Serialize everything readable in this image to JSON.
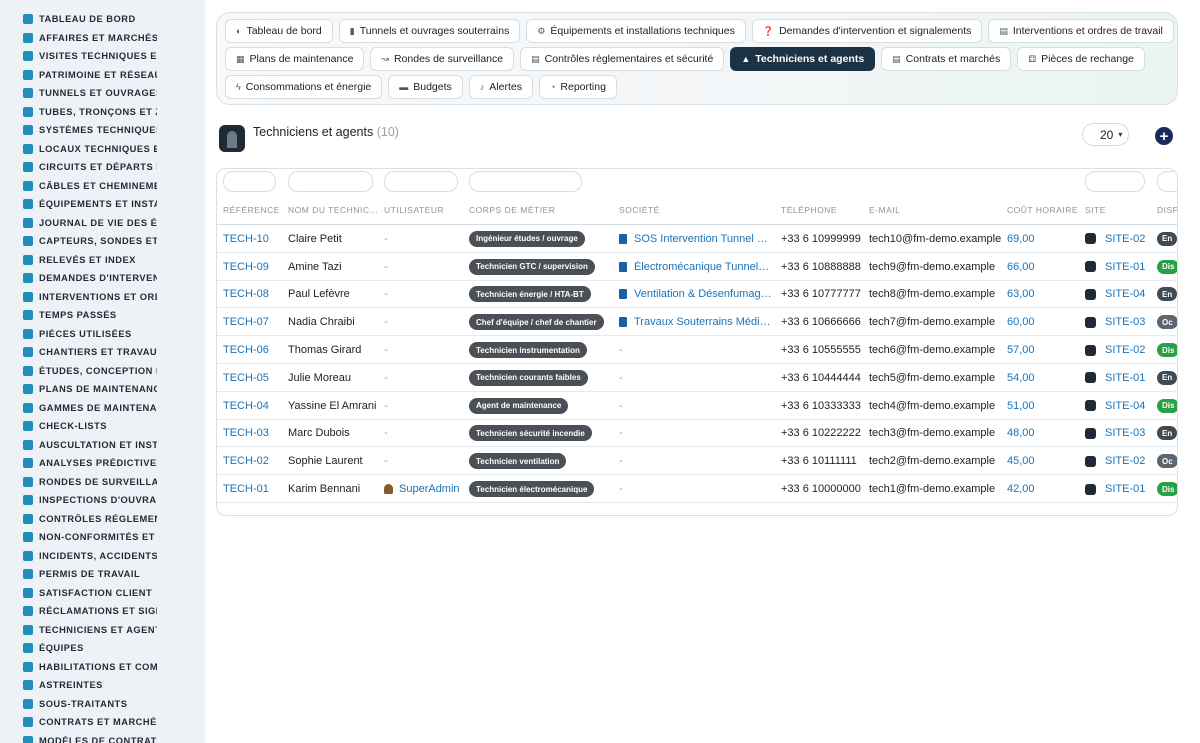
{
  "sidebar": {
    "items": [
      {
        "label": "TABLEAU DE BORD",
        "icon": "dashboard-icon"
      },
      {
        "label": "AFFAIRES ET MARCHÉS",
        "icon": "target-icon"
      },
      {
        "label": "VISITES TECHNIQUES ET",
        "icon": "ruler-icon"
      },
      {
        "label": "PATRIMOINE ET RÉSEAUX",
        "icon": "flag-icon"
      },
      {
        "label": "TUNNELS ET OUVRAGES",
        "icon": "building-icon"
      },
      {
        "label": "TUBES, TRONÇONS ET ZO",
        "icon": "dots-icon"
      },
      {
        "label": "SYSTÈMES TECHNIQUES",
        "icon": "sitemap-icon"
      },
      {
        "label": "LOCAUX TECHNIQUES ET",
        "icon": "grid-icon"
      },
      {
        "label": "CIRCUITS ET DÉPARTS É",
        "icon": "bolt-icon"
      },
      {
        "label": "CÂBLES ET CHEMINEMEN",
        "icon": "cable-icon"
      },
      {
        "label": "ÉQUIPEMENTS ET INSTAL",
        "icon": "gears-icon"
      },
      {
        "label": "JOURNAL DE VIE DES ÉQ",
        "icon": "history-icon"
      },
      {
        "label": "CAPTEURS, SONDES ET C",
        "icon": "sensor-icon"
      },
      {
        "label": "RELEVÉS ET INDEX",
        "icon": "list-icon"
      },
      {
        "label": "DEMANDES D'INTERVENT",
        "icon": "question-icon"
      },
      {
        "label": "INTERVENTIONS ET ORDI",
        "icon": "clipboard-icon"
      },
      {
        "label": "TEMPS PASSÉS",
        "icon": "clock-icon"
      },
      {
        "label": "PIÈCES UTILISÉES",
        "icon": "puzzle-icon"
      },
      {
        "label": "CHANTIERS ET TRAVAUX",
        "icon": "hammer-icon"
      },
      {
        "label": "ÉTUDES, CONCEPTION ET",
        "icon": "pencil-icon"
      },
      {
        "label": "PLANS DE MAINTENANCE",
        "icon": "calendar-icon"
      },
      {
        "label": "GAMMES DE MAINTENAN",
        "icon": "layers-icon"
      },
      {
        "label": "CHECK-LISTS",
        "icon": "checklist-icon"
      },
      {
        "label": "AUSCULTATION ET INSTR",
        "icon": "stethoscope-icon"
      },
      {
        "label": "ANALYSES PRÉDICTIVES",
        "icon": "chart-line-icon"
      },
      {
        "label": "RONDES DE SURVEILLAN",
        "icon": "route-icon"
      },
      {
        "label": "INSPECTIONS D'OUVRAG",
        "icon": "magnifier-icon"
      },
      {
        "label": "CONTRÔLES RÉGLEMENT",
        "icon": "clipboard-check-icon"
      },
      {
        "label": "NON-CONFORMITÉS ET A",
        "icon": "exclamation-icon"
      },
      {
        "label": "INCIDENTS, ACCIDENTS E",
        "icon": "warning-icon"
      },
      {
        "label": "PERMIS DE TRAVAIL",
        "icon": "document-icon"
      },
      {
        "label": "SATISFACTION CLIENT",
        "icon": "smile-icon"
      },
      {
        "label": "RÉCLAMATIONS ET SIGN",
        "icon": "comment-icon"
      },
      {
        "label": "TECHNICIENS ET AGENTS",
        "icon": "hardhat-icon"
      },
      {
        "label": "ÉQUIPES",
        "icon": "users-icon"
      },
      {
        "label": "HABILITATIONS ET COMP",
        "icon": "certificate-icon"
      },
      {
        "label": "ASTREINTES",
        "icon": "phone-icon"
      },
      {
        "label": "SOUS-TRAITANTS",
        "icon": "handshake-icon"
      },
      {
        "label": "CONTRATS ET MARCHÉS",
        "icon": "contract-icon"
      },
      {
        "label": "MODÈLES DE CONTRATS",
        "icon": "file-icon"
      }
    ]
  },
  "tabs": {
    "rows": [
      [
        {
          "label": "Tableau de bord",
          "icon": "dashboard-icon",
          "glyph": "◐",
          "active": false
        },
        {
          "label": "Tunnels et ouvrages souterrains",
          "icon": "building-icon",
          "glyph": "▮",
          "active": false
        },
        {
          "label": "Équipements et installations techniques",
          "icon": "gears-icon",
          "glyph": "⚙",
          "active": false
        },
        {
          "label": "Demandes d'intervention et signalements",
          "icon": "question-icon",
          "glyph": "❓",
          "active": false
        },
        {
          "label": "Interventions et ordres de travail",
          "icon": "clipboard-icon",
          "glyph": "▤",
          "active": false
        }
      ],
      [
        {
          "label": "Plans de maintenance",
          "icon": "calendar-icon",
          "glyph": "▦",
          "active": false
        },
        {
          "label": "Rondes de surveillance",
          "icon": "route-icon",
          "glyph": "↝",
          "active": false
        },
        {
          "label": "Contrôles réglementaires et sécurité",
          "icon": "clipboard-check-icon",
          "glyph": "▤",
          "active": false
        },
        {
          "label": "Techniciens et agents",
          "icon": "hardhat-icon",
          "glyph": "▲",
          "active": true
        },
        {
          "label": "Contrats et marchés",
          "icon": "contract-icon",
          "glyph": "▤",
          "active": false
        },
        {
          "label": "Pièces de rechange",
          "icon": "sitemap-icon",
          "glyph": "⚃",
          "active": false
        }
      ],
      [
        {
          "label": "Consommations et énergie",
          "icon": "bolt-icon",
          "glyph": "ϟ",
          "active": false
        },
        {
          "label": "Budgets",
          "icon": "money-icon",
          "glyph": "▬",
          "active": false
        },
        {
          "label": "Alertes",
          "icon": "bell-icon",
          "glyph": "♪",
          "active": false
        },
        {
          "label": "Reporting",
          "icon": "pie-chart-icon",
          "glyph": "◔",
          "active": false
        }
      ]
    ]
  },
  "page": {
    "title": "Techniciens et agents",
    "count": "(10)",
    "per_page": "20",
    "add_label": "+"
  },
  "table": {
    "columns": [
      "RÉFÉRENCE",
      "NOM DU TECHNIC…",
      "UTILISATEUR",
      "CORPS DE MÉTIER",
      "SOCIÉTÉ",
      "TÉLÉPHONE",
      "E-MAIL",
      "COÛT HORAIRE",
      "SITE",
      "DISPO"
    ],
    "rows": [
      {
        "ref": "TECH-10",
        "name": "Claire Petit",
        "user": "-",
        "trade": "Ingénieur études / ouvrage",
        "company": "SOS Intervention Tunnel 2…",
        "phone": "+33 6 10999999",
        "email": "tech10@fm-demo.example",
        "rate": "69,00",
        "site": "SITE-02",
        "status": "En",
        "status_color": "#3f4a55"
      },
      {
        "ref": "TECH-09",
        "name": "Amine Tazi",
        "user": "-",
        "trade": "Technicien GTC / supervision",
        "company": "Électromécanique Tunnel…",
        "phone": "+33 6 10888888",
        "email": "tech9@fm-demo.example",
        "rate": "66,00",
        "site": "SITE-01",
        "status": "Dis",
        "status_color": "#27a046"
      },
      {
        "ref": "TECH-08",
        "name": "Paul Lefèvre",
        "user": "-",
        "trade": "Technicien énergie / HTA-BT",
        "company": "Ventilation & Désenfumag…",
        "phone": "+33 6 10777777",
        "email": "tech8@fm-demo.example",
        "rate": "63,00",
        "site": "SITE-04",
        "status": "En",
        "status_color": "#3f4a55"
      },
      {
        "ref": "TECH-07",
        "name": "Nadia Chraibi",
        "user": "-",
        "trade": "Chef d'équipe / chef de chantier",
        "company": "Travaux Souterrains Médit…",
        "phone": "+33 6 10666666",
        "email": "tech7@fm-demo.example",
        "rate": "60,00",
        "site": "SITE-03",
        "status": "Oc",
        "status_color": "#5b6670"
      },
      {
        "ref": "TECH-06",
        "name": "Thomas Girard",
        "user": "-",
        "trade": "Technicien instrumentation",
        "company": "-",
        "phone": "+33 6 10555555",
        "email": "tech6@fm-demo.example",
        "rate": "57,00",
        "site": "SITE-02",
        "status": "Dis",
        "status_color": "#27a046"
      },
      {
        "ref": "TECH-05",
        "name": "Julie Moreau",
        "user": "-",
        "trade": "Technicien courants faibles",
        "company": "-",
        "phone": "+33 6 10444444",
        "email": "tech5@fm-demo.example",
        "rate": "54,00",
        "site": "SITE-01",
        "status": "En",
        "status_color": "#3f4a55"
      },
      {
        "ref": "TECH-04",
        "name": "Yassine El Amrani",
        "user": "-",
        "trade": "Agent de maintenance",
        "company": "-",
        "phone": "+33 6 10333333",
        "email": "tech4@fm-demo.example",
        "rate": "51,00",
        "site": "SITE-04",
        "status": "Dis",
        "status_color": "#27a046"
      },
      {
        "ref": "TECH-03",
        "name": "Marc Dubois",
        "user": "-",
        "trade": "Technicien sécurité incendie",
        "company": "-",
        "phone": "+33 6 10222222",
        "email": "tech3@fm-demo.example",
        "rate": "48,00",
        "site": "SITE-03",
        "status": "En",
        "status_color": "#3f4a55"
      },
      {
        "ref": "TECH-02",
        "name": "Sophie Laurent",
        "user": "-",
        "trade": "Technicien ventilation",
        "company": "-",
        "phone": "+33 6 10111111",
        "email": "tech2@fm-demo.example",
        "rate": "45,00",
        "site": "SITE-02",
        "status": "Oc",
        "status_color": "#5b6670"
      },
      {
        "ref": "TECH-01",
        "name": "Karim Bennani",
        "user": "SuperAdmin",
        "trade": "Technicien électromécanique",
        "company": "-",
        "phone": "+33 6 10000000",
        "email": "tech1@fm-demo.example",
        "rate": "42,00",
        "site": "SITE-01",
        "status": "Dis",
        "status_color": "#27a046"
      }
    ]
  },
  "colors": {
    "accent": "#1a73b8",
    "active_tab": "#1b3244",
    "sidebar_bg": "#eef2f6",
    "icon": "#1f8fb8",
    "badge": "#4a5056",
    "available": "#27a046"
  }
}
